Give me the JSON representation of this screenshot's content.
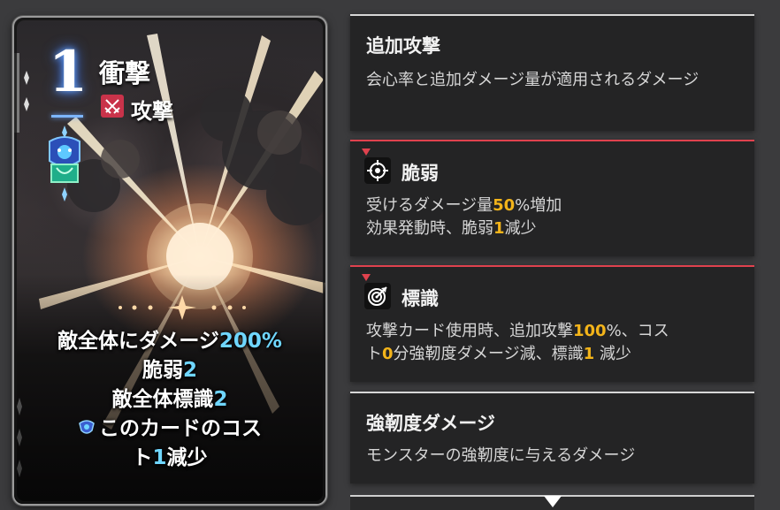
{
  "card": {
    "cost": "1",
    "name": "衝撃",
    "type_label": "攻撃",
    "type_icon": "crossed-swords-icon",
    "emblem_icon": "blue-guardian-emblem-icon",
    "effects": {
      "line1_text": "敵全体にダメージ",
      "line1_value": "200%",
      "line2_text": "脆弱",
      "line2_value": "2",
      "line3_text": "敵全体標識",
      "line3_value": "2",
      "line4_text": "このカードのコス",
      "line5_text_a": "ト",
      "line5_value": "1",
      "line5_text_b": "減少"
    }
  },
  "tooltips": [
    {
      "title": "追加攻撃",
      "desc": "会心率と追加ダメージ量が適用されるダメージ"
    },
    {
      "title": "脆弱",
      "icon": "crosshair-target-icon",
      "desc_a": "受けるダメージ量",
      "desc_value1": "50",
      "desc_b": "%増加",
      "desc_c": "効果発動時、脆弱",
      "desc_value2": "1",
      "desc_d": "減少"
    },
    {
      "title": "標識",
      "icon": "bullseye-mark-icon",
      "desc_a": "攻撃カード使用時、追加攻撃",
      "desc_value1": "100",
      "desc_b": "%、コス",
      "desc_c": "ト",
      "desc_value2": "0",
      "desc_d": "分強靭度ダメージ減、標識",
      "desc_value3": "1",
      "desc_e": " 減少"
    },
    {
      "title": "強靭度ダメージ",
      "desc": "モンスターの強靭度に与えるダメージ"
    }
  ],
  "colors": {
    "highlight_blue": "#6fd6ff",
    "highlight_orange": "#f3b41a",
    "accent_red": "#e0424e",
    "panel_bg": "#242425",
    "page_bg": "#3b3b3d"
  }
}
